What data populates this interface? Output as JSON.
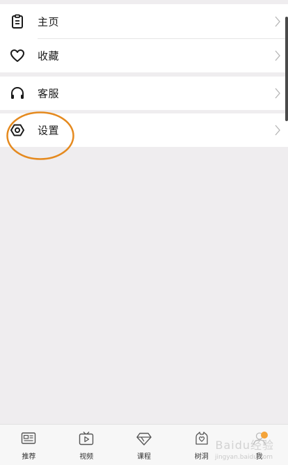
{
  "menu": {
    "group1": [
      {
        "label": "主页",
        "icon": "clipboard-icon"
      },
      {
        "label": "收藏",
        "icon": "heart-icon"
      }
    ],
    "group2": [
      {
        "label": "客服",
        "icon": "headphones-icon"
      }
    ],
    "group3": [
      {
        "label": "设置",
        "icon": "hexagon-settings-icon"
      }
    ]
  },
  "tabbar": {
    "tabs": [
      {
        "label": "推荐",
        "icon": "news-icon"
      },
      {
        "label": "视频",
        "icon": "tv-play-icon"
      },
      {
        "label": "课程",
        "icon": "diamond-icon"
      },
      {
        "label": "树洞",
        "icon": "tree-hole-icon"
      },
      {
        "label": "我",
        "icon": "me-icon",
        "active": true
      }
    ]
  },
  "watermark": {
    "text": "Baidu经验",
    "sub": "jingyan.baidu.com"
  },
  "colors": {
    "highlight_circle": "#e58a1f",
    "active_dot": "#f4a43a",
    "background": "#efedef"
  }
}
